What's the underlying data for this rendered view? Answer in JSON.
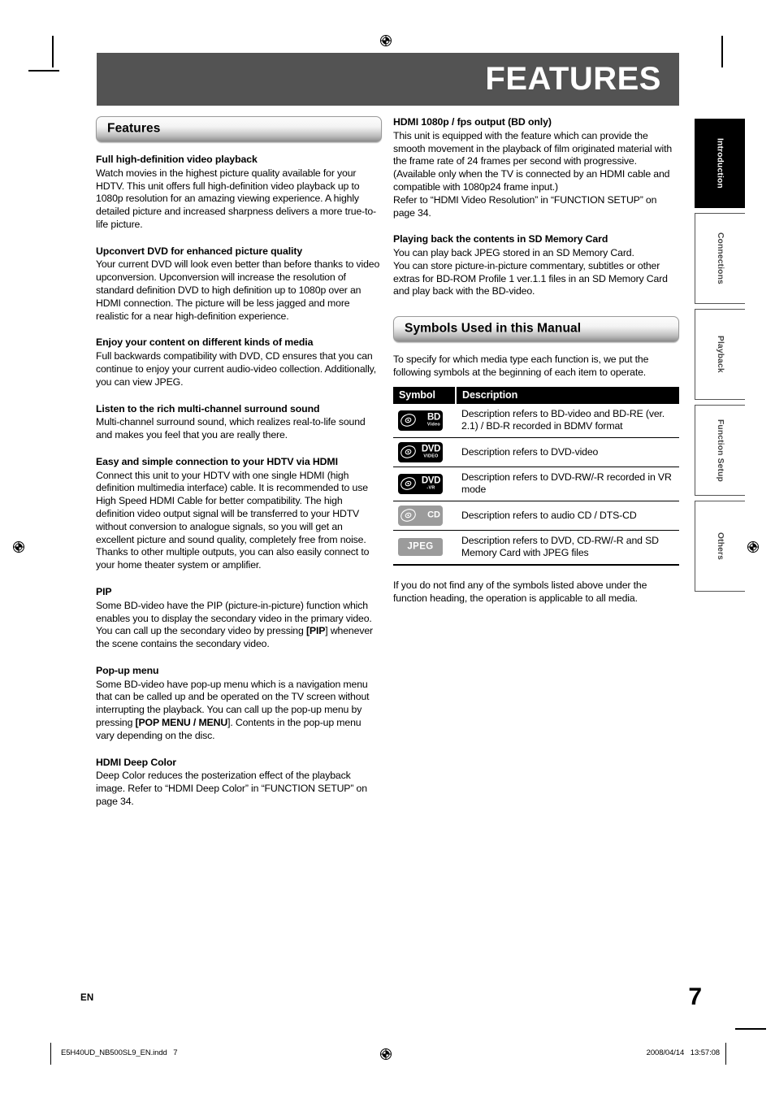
{
  "page": {
    "masthead_title": "FEATURES",
    "language_code": "EN",
    "folio": "7",
    "footer_file": "E5H40UD_NB500SL9_EN.indd   7",
    "footer_date": "2008/04/14   13:57:08"
  },
  "tabs": [
    {
      "label": "Introduction",
      "state": "active"
    },
    {
      "label": "Connections",
      "state": "plain"
    },
    {
      "label": "Playback",
      "state": "plain"
    },
    {
      "label": "Function Setup",
      "state": "plain"
    },
    {
      "label": "Others",
      "state": "plain"
    }
  ],
  "left_column": {
    "section_title": "Features",
    "blocks": [
      {
        "heading": "Full high-definition video playback",
        "paragraphs": [
          "Watch movies in the highest picture quality available for your HDTV. This unit offers full high-definition video playback up to 1080p resolution for an amazing viewing experience. A highly detailed picture and increased sharpness delivers a more true-to-life picture."
        ]
      },
      {
        "heading": "Upconvert DVD for enhanced picture quality",
        "paragraphs": [
          "Your current DVD will look even better than before thanks to video upconversion. Upconversion will increase the resolution of standard definition DVD to high definition up to 1080p over an HDMI connection. The picture will be less jagged and more realistic for a near high-definition experience."
        ]
      },
      {
        "heading": "Enjoy your content on different kinds of media",
        "paragraphs": [
          "Full backwards compatibility with DVD, CD ensures that you can continue to enjoy your current audio-video collection. Additionally, you can view JPEG."
        ]
      },
      {
        "heading": "Listen to the rich multi-channel surround sound",
        "paragraphs": [
          "Multi-channel surround sound, which realizes real-to-life sound and makes you feel that you are really there."
        ]
      },
      {
        "heading": "Easy and simple connection to your HDTV via HDMI",
        "paragraphs": [
          "Connect this unit to your HDTV with one single HDMI (high definition multimedia interface) cable. It is recommended to use High Speed HDMI Cable for better compatibility. The high definition video output signal will be transferred to your HDTV without conversion to analogue signals, so you will get an excellent picture and sound quality, completely free from noise.",
          "Thanks to other multiple outputs, you can also easily connect to your home theater system or amplifier."
        ]
      },
      {
        "heading": "PIP",
        "pip_text_1": "Some BD-video have the PIP (picture-in-picture) function which enables you to display the secondary video in the primary video. You can call up the secondary video by pressing ",
        "pip_key": "[PIP",
        "pip_key_close": "]",
        "pip_text_2": " whenever the scene contains the secondary video."
      },
      {
        "heading": "Pop-up menu",
        "popup_text_1": "Some BD-video have pop-up menu which is a navigation menu that can be called up and be operated on the TV screen without interrupting the playback. You can call up the pop-up menu by pressing ",
        "popup_key": "[POP MENU / MENU",
        "popup_key_close": "]",
        "popup_text_2": ". Contents in the pop-up menu vary depending on the disc."
      },
      {
        "heading": "HDMI Deep Color",
        "paragraphs": [
          "Deep Color reduces the posterization effect of the playback image. Refer to “HDMI Deep Color” in “FUNCTION SETUP” on page 34."
        ]
      }
    ]
  },
  "right_column": {
    "blocks": [
      {
        "heading": "HDMI 1080p / fps output (BD only)",
        "paragraphs": [
          "This unit is equipped with the feature which can provide the smooth movement in the playback of film originated material with the frame rate of 24 frames per second with progressive. (Available only when the TV is connected by an HDMI cable and compatible with 1080p24 frame input.)",
          "Refer to “HDMI Video Resolution” in “FUNCTION SETUP” on page 34."
        ]
      },
      {
        "heading": "Playing back the contents in SD Memory Card",
        "paragraphs": [
          "You can play back JPEG stored in an SD Memory Card.",
          "You can store picture-in-picture commentary, subtitles or other extras for BD-ROM Profile 1 ver.1.1 files in an SD Memory Card and play back with the BD-video."
        ]
      }
    ],
    "section_title": "Symbols Used in this Manual",
    "intro": "To specify for which media type each function is, we put the following symbols at the beginning of each item to operate.",
    "table": {
      "headers": {
        "symbol": "Symbol",
        "description": "Description"
      },
      "rows": [
        {
          "badge_style": "dark",
          "badge_big": "BD",
          "badge_small": "Video",
          "description": "Description refers to BD-video and BD-RE (ver. 2.1) / BD-R recorded in BDMV format"
        },
        {
          "badge_style": "dark",
          "badge_big": "DVD",
          "badge_small": "VIDEO",
          "description": "Description refers to DVD-video"
        },
        {
          "badge_style": "dark",
          "badge_big": "DVD",
          "badge_small": "-VR",
          "description": "Description refers to DVD-RW/-R recorded in VR mode"
        },
        {
          "badge_style": "grey",
          "badge_big": "CD",
          "badge_small": "",
          "description": "Description refers to audio CD / DTS-CD"
        },
        {
          "badge_style": "jpeg",
          "badge_big": "JPEG",
          "badge_small": "",
          "description": "Description refers to DVD, CD-RW/-R and SD Memory Card with JPEG files"
        }
      ]
    },
    "closing": "If you do not find any of the symbols listed above under the function heading, the operation is applicable to all media."
  },
  "colors": {
    "masthead_bg": "#535353",
    "table_header_bg": "#000000",
    "badge_grey": "#9b9b9b",
    "tab_active_bg": "#000000"
  }
}
